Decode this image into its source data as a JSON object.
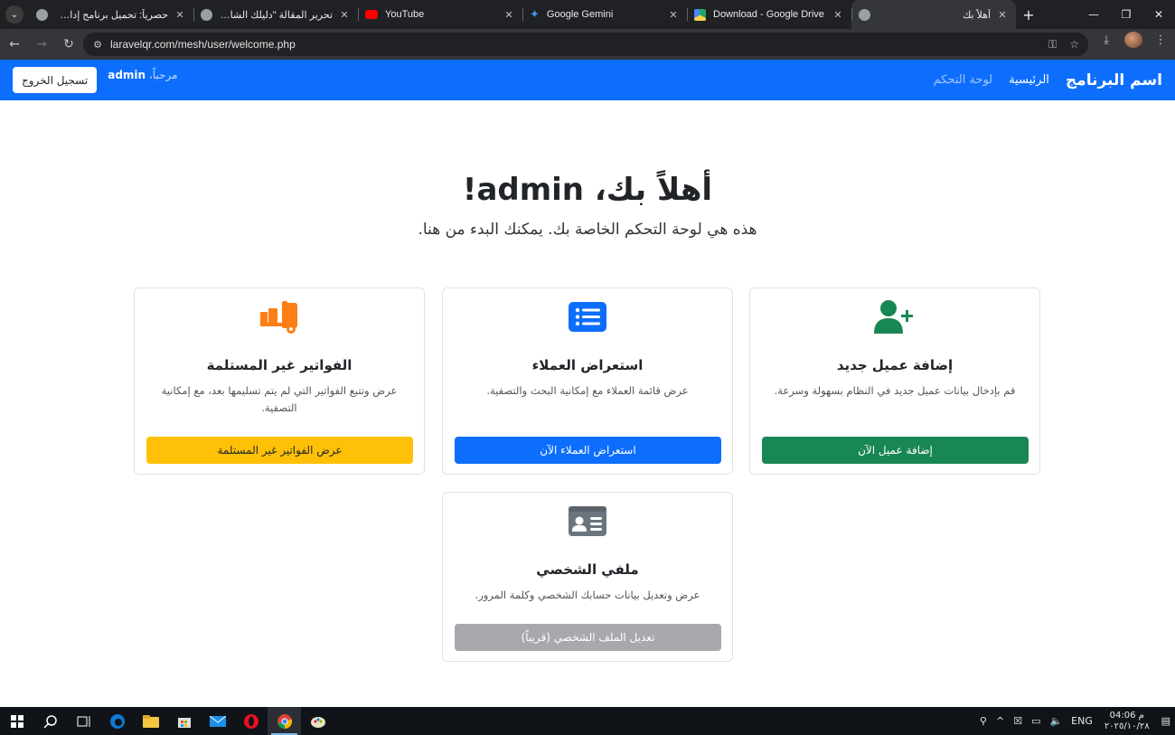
{
  "browser": {
    "tabs": [
      {
        "title": "حصرياً: تحميل برنامج إدارة المخازن",
        "favicon": "globe-icon",
        "rtl": true
      },
      {
        "title": "تحرير المقالة \"دليلك الشامل لاست...",
        "favicon": "globe-icon",
        "rtl": true
      },
      {
        "title": "YouTube",
        "favicon": "youtube-icon",
        "rtl": false
      },
      {
        "title": "Google Gemini",
        "favicon": "gemini-icon",
        "rtl": false
      },
      {
        "title": "Download - Google Drive",
        "favicon": "drive-icon",
        "rtl": false
      },
      {
        "title": "أهلاً بك",
        "favicon": "globe-icon",
        "rtl": true,
        "active": true
      }
    ],
    "url": "laravelqr.com/mesh/user/welcome.php"
  },
  "navbar": {
    "brand": "اسم البرنامج",
    "home_link": "الرئيسية",
    "dashboard_link": "لوحة التحكم",
    "welcome_prefix": "مرحباً،",
    "username": "admin",
    "logout_label": "تسجيل الخروج",
    "color": "#0d6efd"
  },
  "hero": {
    "title": "أهلاً بك، admin!",
    "subtitle": "هذه هي لوحة التحكم الخاصة بك. يمكنك البدء من هنا."
  },
  "cards": {
    "add_client": {
      "icon": "user-plus-icon",
      "title": "إضافة عميل جديد",
      "desc": "قم بإدخال بيانات عميل جديد في النظام بسهولة وسرعة.",
      "button": "إضافة عميل الآن",
      "color": "#198754"
    },
    "view_clients": {
      "icon": "list-icon",
      "title": "استعراض العملاء",
      "desc": "عرض قائمة العملاء مع إمكانية البحث والتصفية.",
      "button": "استعراض العملاء الآن",
      "color": "#0d6efd"
    },
    "undelivered": {
      "icon": "dolly-icon",
      "title": "الفواتير غير المستلمة",
      "desc": "عرض وتتبع الفواتير التي لم يتم تسليمها بعد، مع إمكانية التصفية.",
      "button": "عرض الفواتير غير المستلمة",
      "color": "#ffc107"
    },
    "profile": {
      "icon": "id-card-icon",
      "title": "ملفي الشخصي",
      "desc": "عرض وتعديل بيانات حسابك الشخصي وكلمة المرور.",
      "button": "تعديل الملف الشخصي (قريباً)",
      "color": "#6c757d"
    }
  },
  "taskbar": {
    "language": "ENG",
    "time": "04:06 م",
    "date": "٢٠٢٥/١٠/٢٨"
  }
}
